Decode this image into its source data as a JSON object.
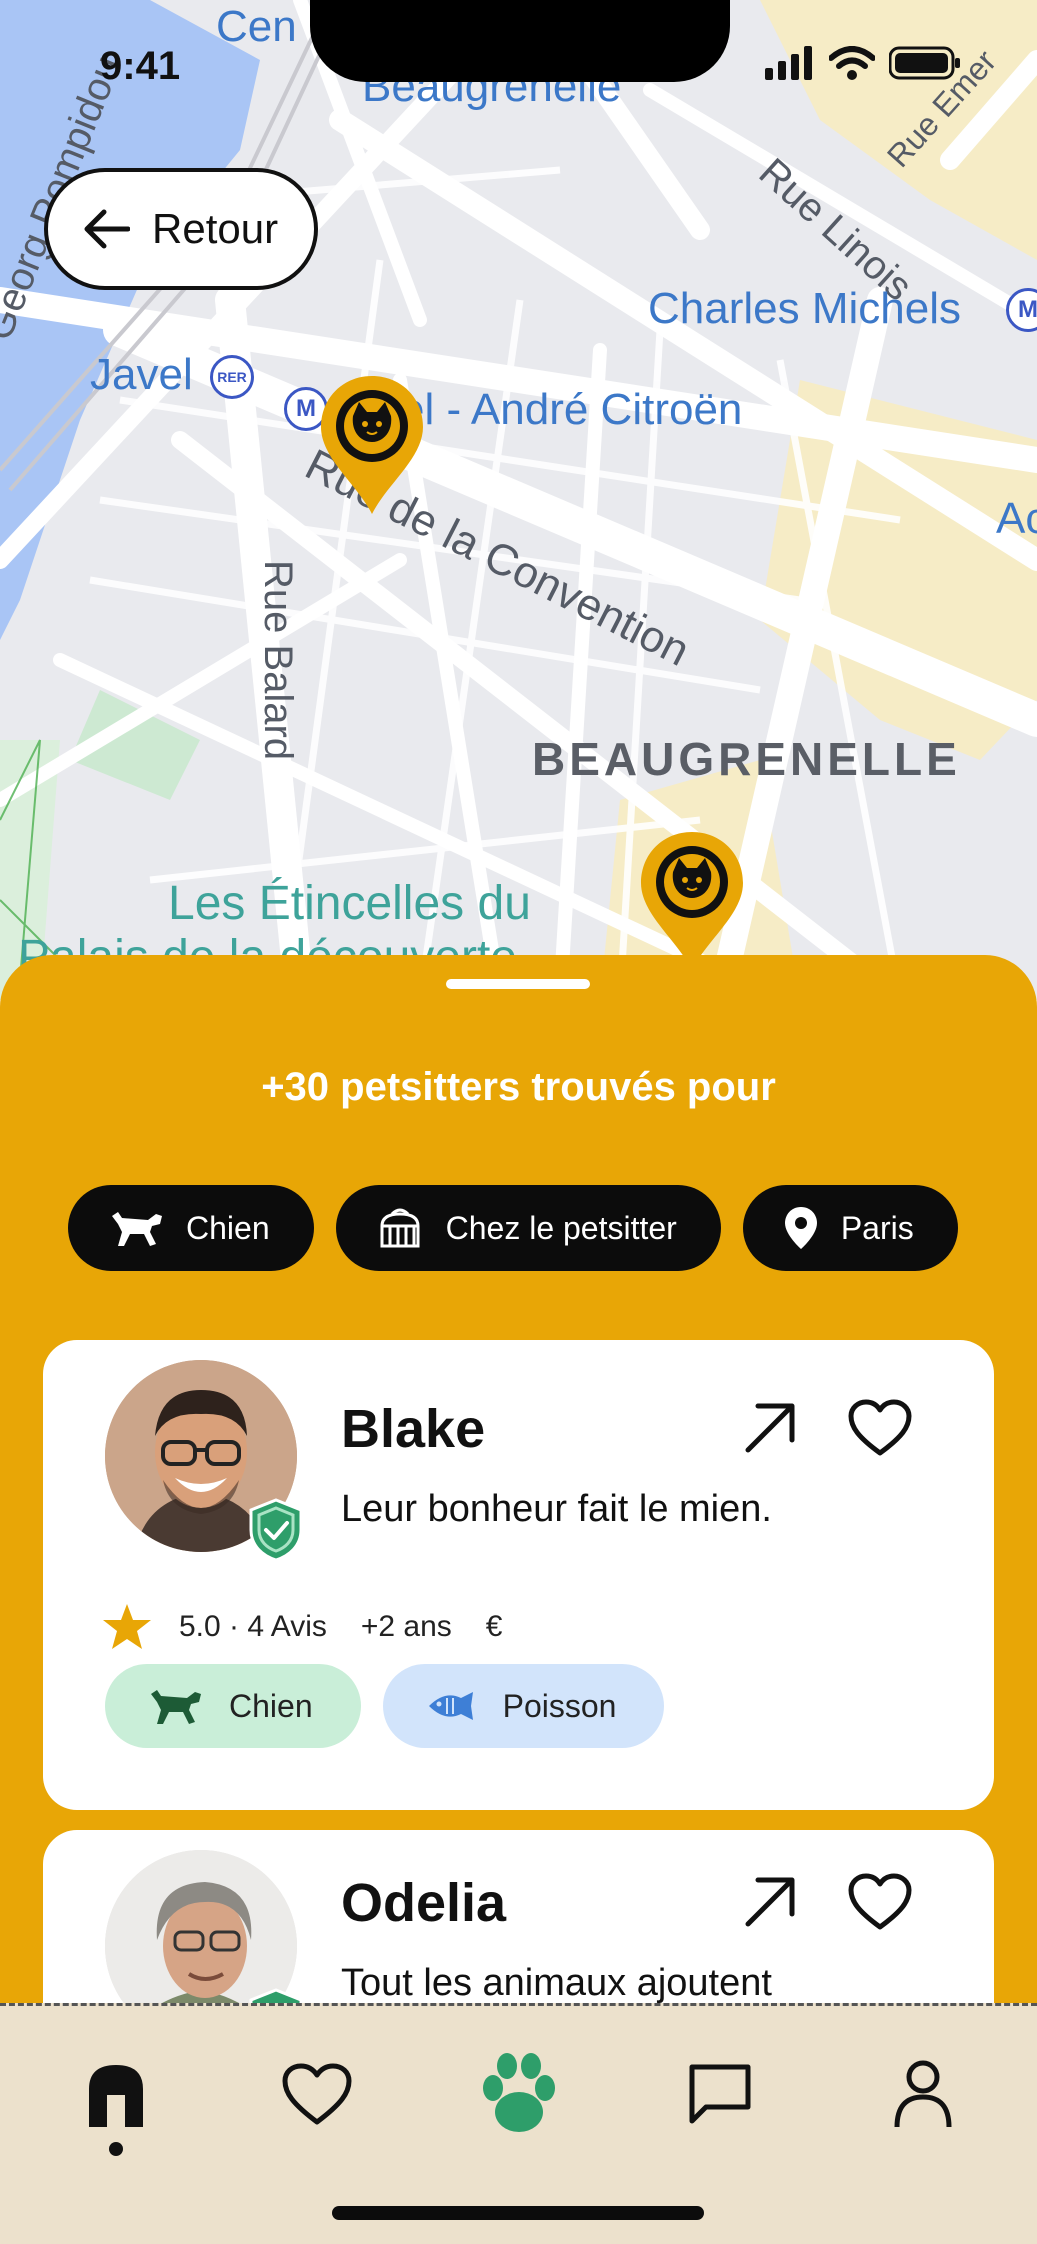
{
  "status_bar": {
    "time": "9:41"
  },
  "back_button": {
    "label": "Retour"
  },
  "map": {
    "labels": {
      "cen": "Cen",
      "beaugrenelle_top": "Beaugrenelle",
      "rue_linois": "Rue Linois",
      "rue_emer": "Rue Emer",
      "charles_michels": "Charles Michels",
      "georg_pompidou": "Georg Pompidou",
      "javel": "Javel",
      "javel_citroen": "el - André Citroën",
      "ac": "Ac",
      "rue_convention": "Rue de la Convention",
      "rue_balard": "Rue Balard",
      "beaugrenelle_district": "BEAUGRENELLE",
      "etincelles_1": "Les Étincelles du",
      "etincelles_2": "Palais de la découverte",
      "metro_m": "M",
      "rer": "RER"
    }
  },
  "sheet": {
    "title": "+30 petsitters trouvés pour",
    "filters": [
      {
        "label": "Chien",
        "icon": "dog-icon"
      },
      {
        "label": "Chez le petsitter",
        "icon": "pet-carrier-icon"
      },
      {
        "label": "Paris",
        "icon": "location-pin-icon"
      }
    ]
  },
  "petsitters": [
    {
      "name": "Blake",
      "tagline": "Leur bonheur fait le mien.",
      "rating": "5.0 · 4 Avis",
      "experience": "+2 ans",
      "price": "€",
      "tags": [
        {
          "label": "Chien",
          "icon": "dog-icon"
        },
        {
          "label": "Poisson",
          "icon": "fish-icon"
        }
      ]
    },
    {
      "name": "Odelia",
      "tagline": "Tout les animaux ajoutent"
    }
  ],
  "tab_bar": {
    "items": [
      "home-icon",
      "heart-icon",
      "paw-icon",
      "chat-icon",
      "profile-icon"
    ],
    "active": "home"
  },
  "colors": {
    "sheet_background": "#E8A606",
    "accent_green": "#2E9E6A",
    "tab_bar_background": "#ECE1CC",
    "map_pin": "#E8A606"
  }
}
